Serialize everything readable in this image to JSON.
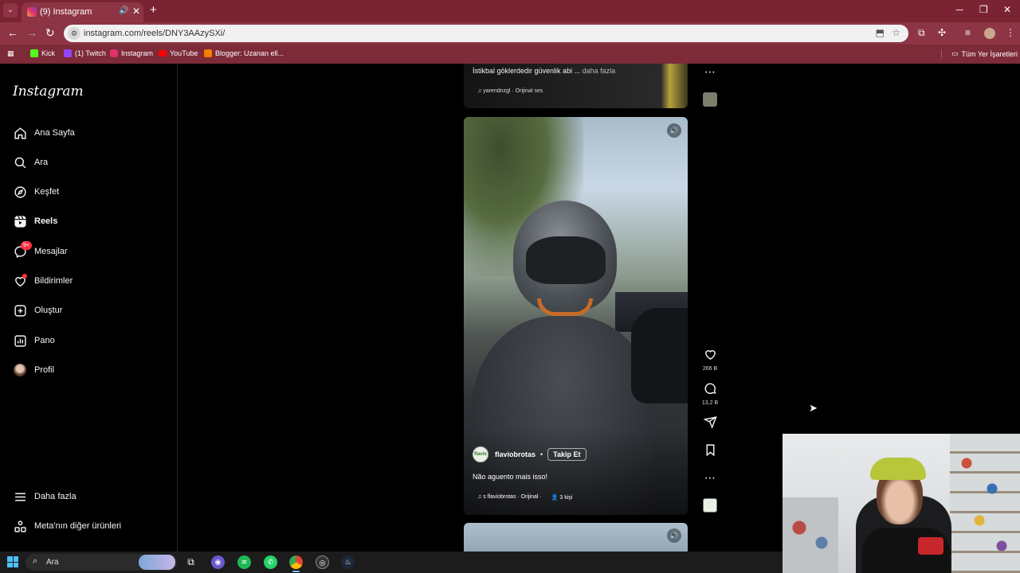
{
  "browser": {
    "tab_title": "(9) Instagram",
    "url": "instagram.com/reels/DNY3AAzySXi/",
    "bookmarks": [
      {
        "label": "Kick",
        "color": "#53fc18"
      },
      {
        "label": "(1) Twitch",
        "color": "#9146ff"
      },
      {
        "label": "Instagram",
        "color": "#e1306c"
      },
      {
        "label": "YouTube",
        "color": "#ff0000"
      },
      {
        "label": "Blogger: Uzanan ell...",
        "color": "#f57d00"
      }
    ],
    "all_bookmarks": "Tüm Yer İşaretleri"
  },
  "sidebar": {
    "logo": "Instagram",
    "items": [
      {
        "label": "Ana Sayfa",
        "icon": "home-icon"
      },
      {
        "label": "Ara",
        "icon": "search-icon"
      },
      {
        "label": "Keşfet",
        "icon": "compass-icon"
      },
      {
        "label": "Reels",
        "icon": "reels-icon",
        "active": true
      },
      {
        "label": "Mesajlar",
        "icon": "messenger-icon",
        "badge": "9+"
      },
      {
        "label": "Bildirimler",
        "icon": "heart-icon",
        "dot": true
      },
      {
        "label": "Oluştur",
        "icon": "plus-square-icon"
      },
      {
        "label": "Pano",
        "icon": "chart-icon"
      },
      {
        "label": "Profil",
        "icon": "profile-avatar"
      }
    ],
    "more": "Daha fazla",
    "meta": "Meta'nın diğer ürünleri"
  },
  "reel_prev": {
    "caption": "İstikbal göklerdedir güvenlik abi ...",
    "more": "daha fazla",
    "audio": "yarendnzgl · Orijinal ses"
  },
  "reel": {
    "username": "flaviobrotas",
    "avatar_text": "flavio",
    "follow": "Takip Et",
    "caption": "Não aguento mais isso!",
    "audio": "s   flaviobrotas · Orijinal ·",
    "people": "3 kişi",
    "likes": "266 B",
    "comments": "13,2 B"
  },
  "taskbar": {
    "search": "Ara"
  },
  "colors": {
    "browser_frame": "#7a2433",
    "toolbar": "#8d3545",
    "badge_red": "#ff3040"
  }
}
